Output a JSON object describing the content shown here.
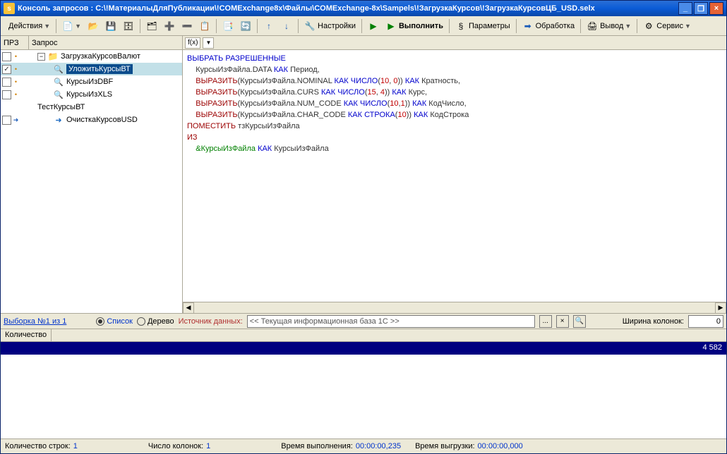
{
  "titlebar": {
    "title": "Консоль запросов : C:\\!МатериалыДляПубликации\\!COMExchange8x\\Файлы\\COMExchange-8x\\Sampels\\!ЗагрузкаКурсов\\!ЗагрузкаКурсовЦБ_USD.selx"
  },
  "win_controls": {
    "min": "_",
    "max": "❐",
    "close": "×"
  },
  "toolbar": {
    "actions": "Действия",
    "settings": "Настройки",
    "execute": "Выполнить",
    "parameters": "Параметры",
    "processing": "Обработка",
    "output": "Вывод",
    "service": "Сервис"
  },
  "tree_header": {
    "col1": "ПРЗ",
    "col2": "Запрос"
  },
  "tree": {
    "items": [
      {
        "label": "ЗагрузкаКурсовВалют",
        "type": "folder",
        "indent": 0,
        "checked": false
      },
      {
        "label": "УложитьКурсыВТ",
        "type": "leaf",
        "indent": 1,
        "checked": true,
        "selected": true
      },
      {
        "label": "КурсыИзDBF",
        "type": "leaf",
        "indent": 1,
        "checked": false
      },
      {
        "label": "КурсыИзXLS",
        "type": "leaf",
        "indent": 1,
        "checked": false
      },
      {
        "label": "ТестКурсыВТ",
        "type": "group",
        "indent": 0
      },
      {
        "label": "ОчисткаКурсовUSD",
        "type": "leaf",
        "indent": 1,
        "checked": false,
        "icon": "arrow"
      }
    ]
  },
  "code": {
    "fx": "f(x)",
    "lines": [
      [
        [
          "kw",
          "ВЫБРАТЬ РАЗРЕШЕННЫЕ"
        ]
      ],
      [
        [
          "pad",
          "    "
        ],
        [
          "ident",
          "КурсыИзФайла.DATA "
        ],
        [
          "kw",
          "КАК"
        ],
        [
          "ident",
          " Период,"
        ]
      ],
      [
        [
          "pad",
          "    "
        ],
        [
          "fn",
          "ВЫРАЗИТЬ"
        ],
        [
          "ident",
          "(КурсыИзФайла.NOMINAL "
        ],
        [
          "kw",
          "КАК ЧИСЛО"
        ],
        [
          "ident",
          "("
        ],
        [
          "num",
          "10"
        ],
        [
          "ident",
          ", "
        ],
        [
          "num",
          "0"
        ],
        [
          "ident",
          ")) "
        ],
        [
          "kw",
          "КАК"
        ],
        [
          "ident",
          " Кратность,"
        ]
      ],
      [
        [
          "pad",
          "    "
        ],
        [
          "fn",
          "ВЫРАЗИТЬ"
        ],
        [
          "ident",
          "(КурсыИзФайла.CURS "
        ],
        [
          "kw",
          "КАК ЧИСЛО"
        ],
        [
          "ident",
          "("
        ],
        [
          "num",
          "15"
        ],
        [
          "ident",
          ", "
        ],
        [
          "num",
          "4"
        ],
        [
          "ident",
          ")) "
        ],
        [
          "kw",
          "КАК"
        ],
        [
          "ident",
          " Курс,"
        ]
      ],
      [
        [
          "pad",
          "    "
        ],
        [
          "fn",
          "ВЫРАЗИТЬ"
        ],
        [
          "ident",
          "(КурсыИзФайла.NUM_CODE "
        ],
        [
          "kw",
          "КАК ЧИСЛО"
        ],
        [
          "ident",
          "("
        ],
        [
          "num",
          "10"
        ],
        [
          "ident",
          ","
        ],
        [
          "num",
          "1"
        ],
        [
          "ident",
          ")) "
        ],
        [
          "kw",
          "КАК"
        ],
        [
          "ident",
          " КодЧисло,"
        ]
      ],
      [
        [
          "pad",
          "    "
        ],
        [
          "fn",
          "ВЫРАЗИТЬ"
        ],
        [
          "ident",
          "(КурсыИзФайла.CHAR_CODE "
        ],
        [
          "kw",
          "КАК СТРОКА"
        ],
        [
          "ident",
          "("
        ],
        [
          "num",
          "10"
        ],
        [
          "ident",
          ")) "
        ],
        [
          "kw",
          "КАК"
        ],
        [
          "ident",
          " КодСтрока"
        ]
      ],
      [
        [
          "kw2",
          "ПОМЕСТИТЬ"
        ],
        [
          "ident",
          " тзКурсыИзФайла"
        ]
      ],
      [
        [
          "kw2",
          "ИЗ"
        ]
      ],
      [
        [
          "pad",
          "    "
        ],
        [
          "amp",
          "&КурсыИзФайла"
        ],
        [
          "ident",
          " "
        ],
        [
          "kw",
          "КАК"
        ],
        [
          "ident",
          " КурсыИзФайла"
        ]
      ]
    ]
  },
  "middle": {
    "selection_link": "Выборка №1 из 1",
    "radio_list": "Список",
    "radio_tree": "Дерево",
    "source_label": "Источник данных:",
    "source_value": "<< Текущая информационная база 1С >>",
    "ellipsis": "...",
    "clear": "×",
    "lookup": "🔍",
    "width_label": "Ширина колонок:",
    "width_value": "0"
  },
  "result": {
    "header": "Количество",
    "value": "4 582"
  },
  "status": {
    "rows_label": "Количество строк:",
    "rows_value": "1",
    "cols_label": "Число колонок:",
    "cols_value": "1",
    "exec_label": "Время выполнения:",
    "exec_value": "00:00:00,235",
    "unload_label": "Время выгрузки:",
    "unload_value": "00:00:00,000"
  },
  "icons": {
    "new": "📄",
    "open": "📂",
    "save": "💾",
    "save_all": "🗄",
    "tree1": "🗂",
    "tree2": "➕",
    "tree3": "➖",
    "tree4": "📋",
    "copy": "📑",
    "exec_icon": "▶",
    "up": "↑",
    "down": "↓",
    "refresh": "🔄",
    "settings_icon": "🔧",
    "params_icon": "§",
    "proc_icon": "➡",
    "out_icon": "🖨",
    "srv_icon": "⚙",
    "tri": "▼"
  }
}
